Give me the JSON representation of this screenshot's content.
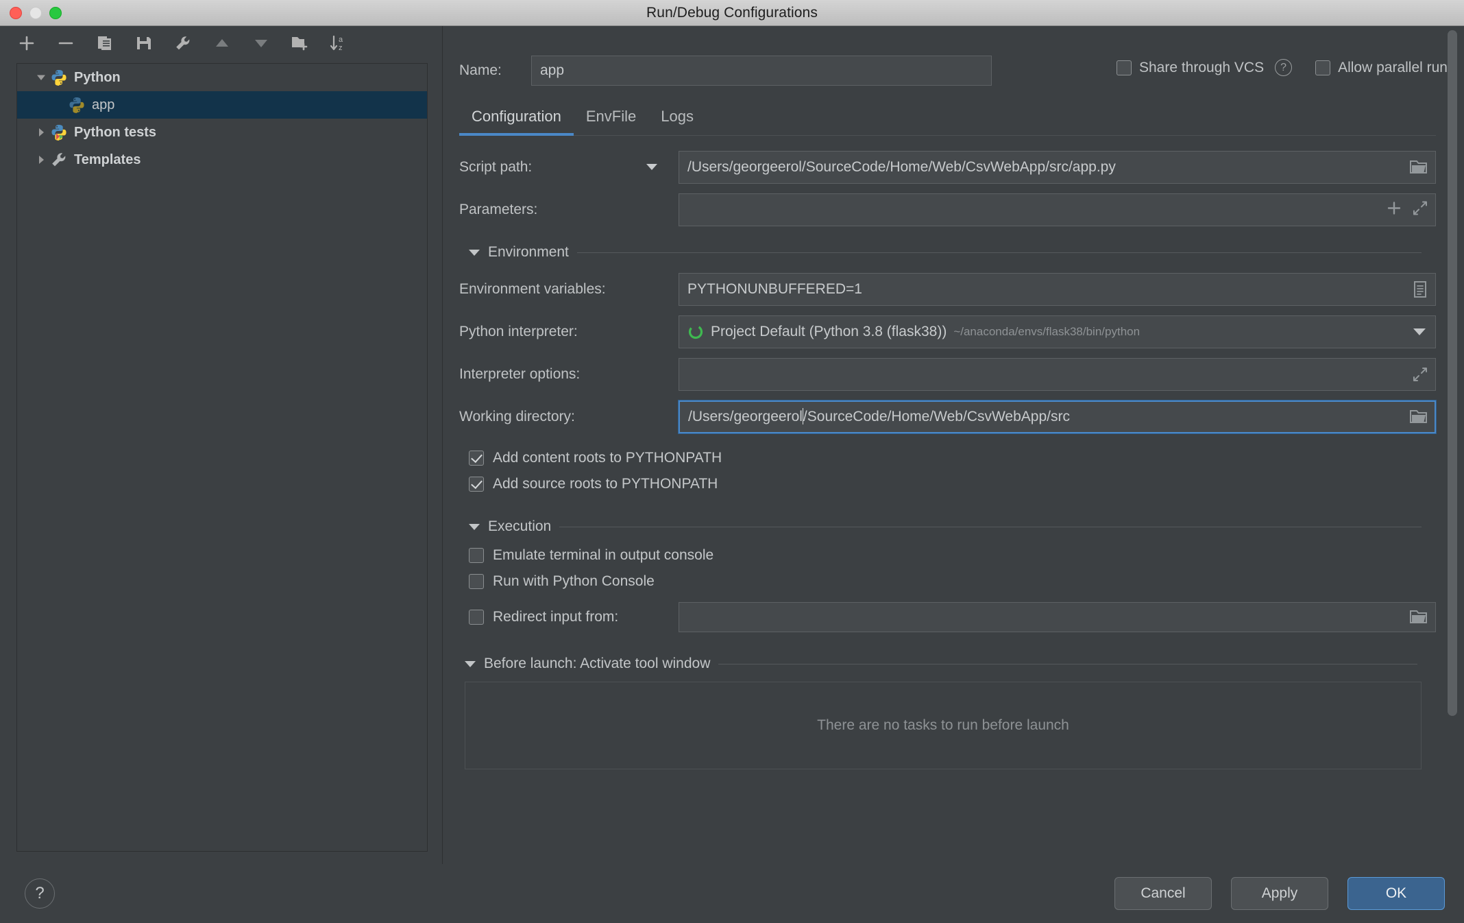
{
  "window": {
    "title": "Run/Debug Configurations",
    "traffic_lights": [
      "close-red",
      "minimize-yellow",
      "maximize-green"
    ]
  },
  "toolbar": {
    "buttons": [
      {
        "name": "add-configuration-button",
        "icon": "plus-icon",
        "enabled": true
      },
      {
        "name": "remove-configuration-button",
        "icon": "minus-icon",
        "enabled": true
      },
      {
        "name": "copy-configuration-button",
        "icon": "copy-icon",
        "enabled": true
      },
      {
        "name": "save-configuration-button",
        "icon": "save-icon",
        "enabled": true
      },
      {
        "name": "edit-templates-button",
        "icon": "wrench-icon",
        "enabled": true
      },
      {
        "name": "move-up-button",
        "icon": "arrow-up-icon",
        "enabled": false
      },
      {
        "name": "move-down-button",
        "icon": "arrow-down-icon",
        "enabled": false
      },
      {
        "name": "new-folder-button",
        "icon": "folder-add-icon",
        "enabled": true
      },
      {
        "name": "sort-alphabetically-button",
        "icon": "sort-az-icon",
        "enabled": true
      }
    ]
  },
  "tree": {
    "items": [
      {
        "label": "Python",
        "icon": "python-icon",
        "expanded": true,
        "selected": false,
        "indent": 0
      },
      {
        "label": "app",
        "icon": "python-file-icon",
        "expanded": null,
        "selected": true,
        "indent": 1
      },
      {
        "label": "Python tests",
        "icon": "python-tests-icon",
        "expanded": false,
        "selected": false,
        "indent": 0
      },
      {
        "label": "Templates",
        "icon": "wrench-icon",
        "expanded": false,
        "selected": false,
        "indent": 0
      }
    ]
  },
  "header": {
    "name_label": "Name:",
    "name_value": "app",
    "name_placeholder": "",
    "share_vcs_label": "Share through VCS",
    "share_vcs_checked": false,
    "help_icon": "question-mark-icon",
    "allow_parallel_label": "Allow parallel run",
    "allow_parallel_checked": false
  },
  "tabs": [
    {
      "label": "Configuration",
      "active": true
    },
    {
      "label": "EnvFile",
      "active": false
    },
    {
      "label": "Logs",
      "active": false
    }
  ],
  "form": {
    "script_path": {
      "label": "Script path:",
      "value": "/Users/georgeerol/SourceCode/Home/Web/CsvWebApp/src/app.py",
      "browse_icon": "folder-icon",
      "dropdown_icon": "chevron-down-icon"
    },
    "parameters": {
      "label": "Parameters:",
      "value": "",
      "add_icon": "plus-icon",
      "expand_icon": "expand-icon"
    },
    "environment_section": {
      "title": "Environment",
      "expanded": true
    },
    "environment_variables": {
      "label": "Environment variables:",
      "value": "PYTHONUNBUFFERED=1",
      "edit_icon": "list-edit-icon"
    },
    "python_interpreter": {
      "label": "Python interpreter:",
      "value": "Project Default (Python 3.8 (flask38))",
      "path_hint": "~/anaconda/envs/flask38/bin/python",
      "status_icon": "python-env-icon",
      "dropdown_icon": "chevron-down-icon"
    },
    "interpreter_options": {
      "label": "Interpreter options:",
      "value": "",
      "expand_icon": "expand-icon"
    },
    "working_directory": {
      "label": "Working directory:",
      "value_before_caret": "/Users/georgeerol",
      "value_after_caret": "/SourceCode/Home/Web/CsvWebApp/src",
      "full_value": "/Users/georgeerol/SourceCode/Home/Web/CsvWebApp/src",
      "focused": true,
      "browse_icon": "folder-icon"
    },
    "add_content_roots": {
      "label": "Add content roots to PYTHONPATH",
      "checked": true
    },
    "add_source_roots": {
      "label": "Add source roots to PYTHONPATH",
      "checked": true
    },
    "execution_section": {
      "title": "Execution",
      "expanded": true
    },
    "emulate_terminal": {
      "label": "Emulate terminal in output console",
      "checked": false
    },
    "run_with_python_console": {
      "label": "Run with Python Console",
      "checked": false
    },
    "redirect_input": {
      "label": "Redirect input from:",
      "checked": false,
      "value": "",
      "browse_icon": "folder-icon"
    },
    "before_launch": {
      "title": "Before launch: Activate tool window",
      "expanded": true,
      "empty_text": "There are no tasks to run before launch"
    }
  },
  "footer": {
    "help_label": "?",
    "cancel_label": "Cancel",
    "apply_label": "Apply",
    "ok_label": "OK"
  },
  "colors": {
    "accent_blue": "#4a88c7",
    "selection_blue": "#12334a",
    "ok_button_blue": "#3b648f",
    "background": "#3c4043",
    "field_background": "#45494c",
    "text_primary": "#c0c3c5",
    "text_muted": "#8e9295",
    "python_blue": "#4b8bbe",
    "python_yellow": "#ffd43b",
    "green_status": "#3fb950"
  }
}
